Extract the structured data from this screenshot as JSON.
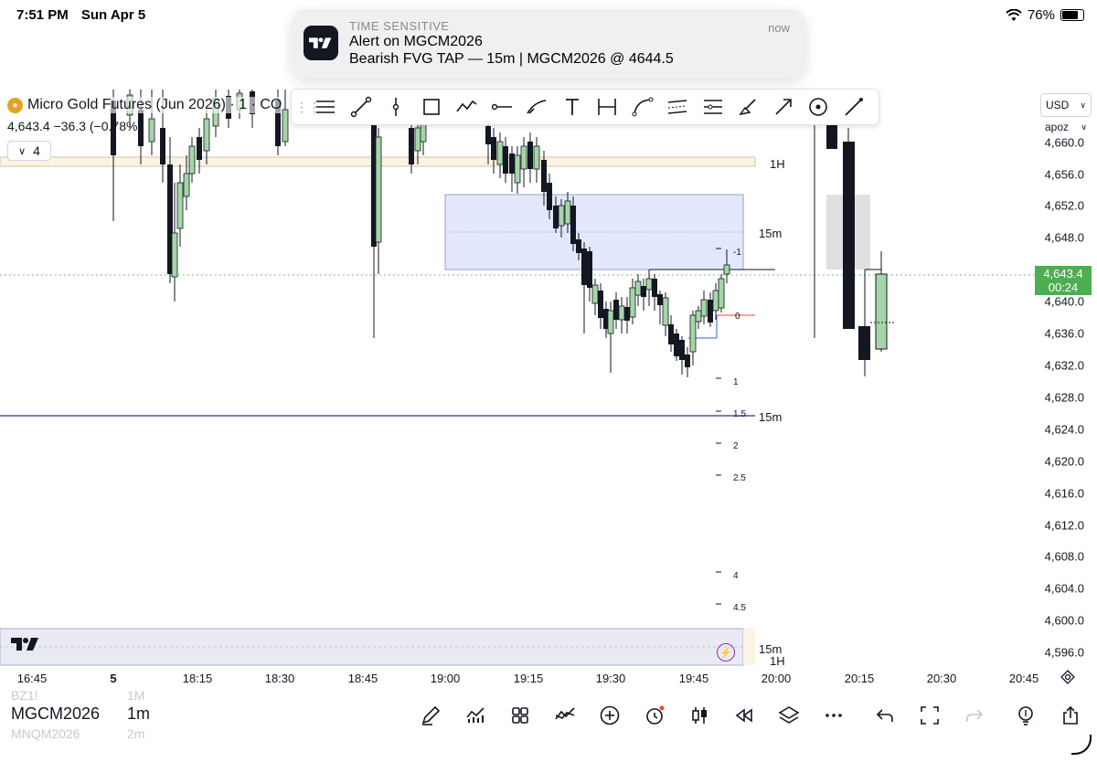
{
  "status_bar": {
    "time": "7:51 PM",
    "date": "Sun Apr 5",
    "battery": "76%"
  },
  "notification": {
    "tag": "TIME SENSITIVE",
    "time": "now",
    "title": "Alert on MGCM2026",
    "body": "Bearish FVG TAP — 15m | MGCM2026 @ 4644.5"
  },
  "legend": {
    "symbol_title": "Micro Gold Futures (Jun 2026) · 1 · CO",
    "price_change": "4,643.4  −36.3 (−0.78%)",
    "collapse_count": "4"
  },
  "drawing_tools": [
    "horizontal-lines-icon",
    "trend-line-icon",
    "vertical-line-icon",
    "rectangle-icon",
    "path-icon",
    "horizontal-ray-icon",
    "curve-icon",
    "text-icon",
    "price-range-icon",
    "arc-icon",
    "parallel-channel-icon",
    "fib-icon",
    "brush-icon",
    "arrow-icon",
    "target-icon",
    "pen-icon"
  ],
  "currency": {
    "value": "USD",
    "scale": "apoz"
  },
  "price_axis": [
    "4,660.0",
    "4,656.0",
    "4,652.0",
    "4,648.0",
    "4,640.0",
    "4,636.0",
    "4,632.0",
    "4,628.0",
    "4,624.0",
    "4,620.0",
    "4,616.0",
    "4,612.0",
    "4,608.0",
    "4,604.0",
    "4,600.0",
    "4,596.0"
  ],
  "current_price": {
    "price": "4,643.4",
    "countdown": "00:24"
  },
  "time_axis": [
    "16:45",
    "5",
    "18:15",
    "18:30",
    "18:45",
    "19:00",
    "19:15",
    "19:30",
    "19:45",
    "20:00",
    "20:15",
    "20:30",
    "20:45"
  ],
  "chart_labels": {
    "tf_1h": "1H",
    "tf_15m_upper": "15m",
    "tf_15m_mid": "15m",
    "tf_15m_lower": "15m",
    "tf_1h_lower": "1H"
  },
  "fib_levels": [
    "-1",
    "0",
    "1",
    "1.5",
    "2",
    "2.5",
    "4",
    "4.5"
  ],
  "bottom_bar": {
    "symbol": "MGCM2026",
    "interval": "1m",
    "ghost_prev_symbol": "BZ1!",
    "ghost_prev_interval": "1M",
    "ghost_next_symbol": "MNQM2026",
    "ghost_next_interval": "2m"
  },
  "colors": {
    "bull": "#a5d6a7",
    "bear": "#131722",
    "accent": "#2962ff",
    "price_green": "#4caf50",
    "fvg_fill": "#e3e9fd"
  }
}
